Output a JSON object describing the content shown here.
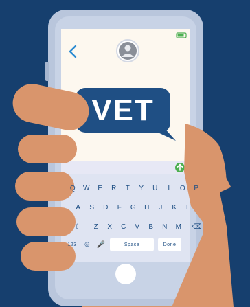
{
  "message": {
    "text": "VET"
  },
  "keyboard": {
    "row1": [
      "Q",
      "W",
      "E",
      "R",
      "T",
      "Y",
      "U",
      "I",
      "O",
      "P"
    ],
    "row2": [
      "A",
      "S",
      "D",
      "F",
      "G",
      "H",
      "J",
      "K",
      "L"
    ],
    "row3": [
      "Z",
      "X",
      "C",
      "V",
      "B",
      "N",
      "M"
    ],
    "row4": {
      "numbers": "123",
      "space": "Space",
      "done": "Done"
    }
  },
  "icons": {
    "back": "chevron-left-icon",
    "avatar": "user-avatar-icon",
    "battery": "battery-icon",
    "send": "send-arrow-icon",
    "shift": "shift-icon",
    "backspace": "backspace-icon",
    "emoji": "emoji-icon",
    "mic": "microphone-icon"
  },
  "colors": {
    "background": "#163f6e",
    "phone_frame": "#b9c6dc",
    "screen": "#fdf8ef",
    "keyboard": "#dfe4f2",
    "bubble": "#1f4f84",
    "accent_blue": "#2b8bd1",
    "send_green": "#4caf50",
    "skin": "#d9956c",
    "sleeve": "#163f6e"
  }
}
